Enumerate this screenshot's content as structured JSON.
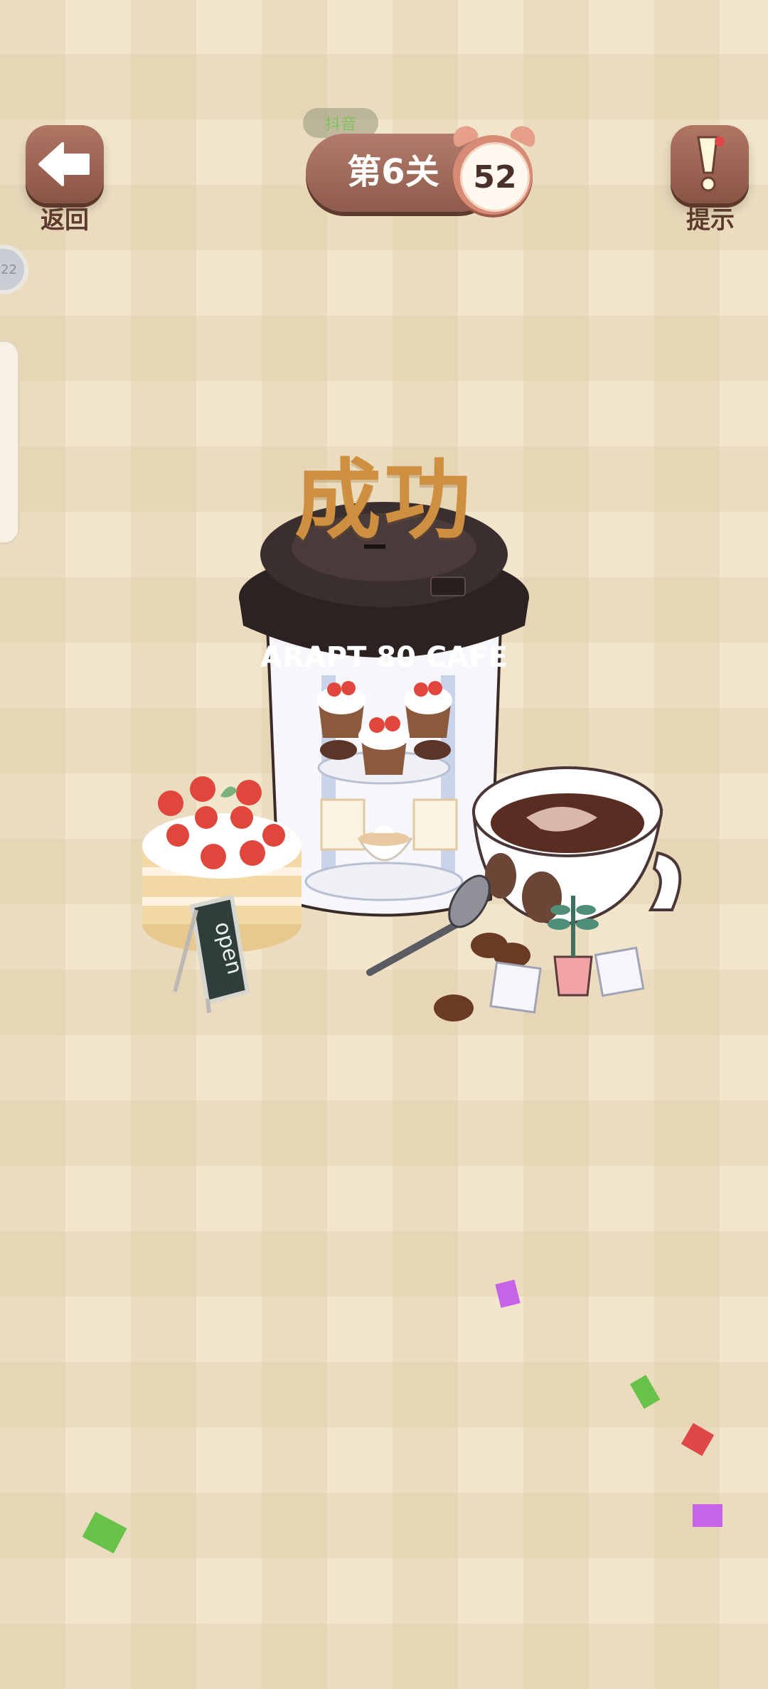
{
  "topbar": {
    "back_label": "返回",
    "hint_label": "提示",
    "level_label": "第6关",
    "timer_value": "52",
    "badge_text": "抖音"
  },
  "side": {
    "dot_text": "22"
  },
  "result": {
    "title": "成功"
  },
  "scene": {
    "cup_band_text": "ARAPT 80 CAFE",
    "sign_text": "open"
  },
  "colors": {
    "button_brown": "#9a6453",
    "title_gold": "#cf8f40",
    "background": "#f1e5cb",
    "confetti": [
      "#c564e6",
      "#67c24a",
      "#e04848",
      "#c564e6",
      "#67c24a"
    ]
  },
  "icons": [
    "back-arrow-icon",
    "exclamation-icon",
    "alarm-clock-icon"
  ]
}
